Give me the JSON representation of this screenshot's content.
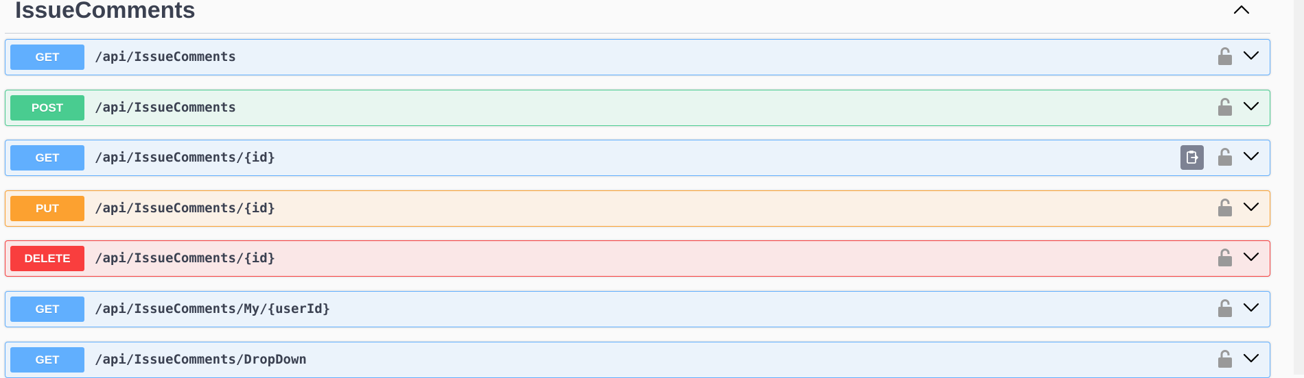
{
  "tag": {
    "title": "IssueComments"
  },
  "operations": [
    {
      "method": "GET",
      "path": "/api/IssueComments"
    },
    {
      "method": "POST",
      "path": "/api/IssueComments"
    },
    {
      "method": "GET",
      "path": "/api/IssueComments/{id}"
    },
    {
      "method": "PUT",
      "path": "/api/IssueComments/{id}"
    },
    {
      "method": "DELETE",
      "path": "/api/IssueComments/{id}"
    },
    {
      "method": "GET",
      "path": "/api/IssueComments/My/{userId}"
    },
    {
      "method": "GET",
      "path": "/api/IssueComments/DropDown"
    }
  ],
  "icons": {
    "collapse": "chevron-up-icon",
    "expand": "chevron-down-icon",
    "authorize": "unlocked-padlock-icon",
    "copy": "copy-to-clipboard-icon"
  },
  "colors": {
    "get": "#61affe",
    "post": "#49cc90",
    "put": "#fca130",
    "delete": "#f93e3e",
    "text": "#3b4151"
  }
}
